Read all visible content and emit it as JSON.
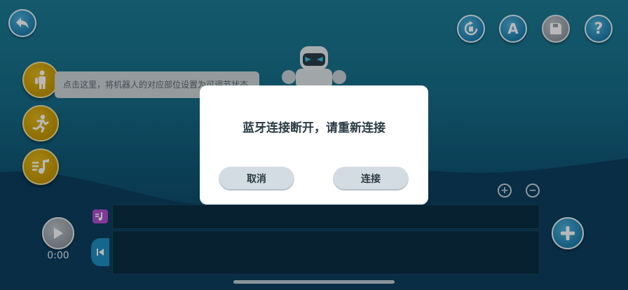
{
  "toolbar": {
    "back_icon": "back-arrow-icon",
    "reset_icon": "reset-icon",
    "text_icon_letter": "A",
    "save_icon": "save-icon",
    "help_icon_letter": "?"
  },
  "hint": {
    "text": "点击这里，将机器人的对应部位设置为可调节状态"
  },
  "side_tools": [
    {
      "icon": "person-stand-icon"
    },
    {
      "icon": "person-run-icon"
    },
    {
      "icon": "music-list-icon"
    }
  ],
  "dialog": {
    "title": "蓝牙连接断开，请重新连接",
    "cancel_label": "取消",
    "connect_label": "连接"
  },
  "timeline": {
    "time": "0:00",
    "zoom_in_symbol": "+",
    "zoom_out_symbol": "−"
  },
  "colors": {
    "accent_blue": "#1d7fb0",
    "tool_yellow": "#c39600",
    "dialog_button": "#d3dce2",
    "music_tag": "#b24fcf"
  }
}
